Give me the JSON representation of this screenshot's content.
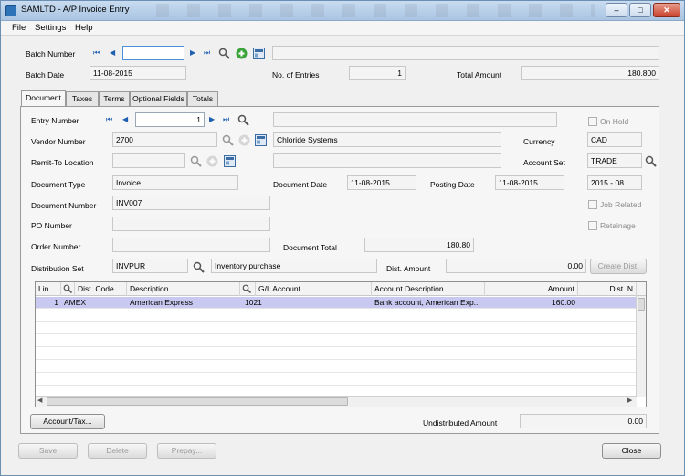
{
  "window": {
    "title": "SAMLTD - A/P Invoice Entry",
    "controls": {
      "minimize": "–",
      "maximize": "□",
      "close": "✕"
    }
  },
  "menu": [
    "File",
    "Settings",
    "Help"
  ],
  "header": {
    "batch_number_label": "Batch Number",
    "batch_number_value": "",
    "batch_date_label": "Batch Date",
    "batch_date_value": "11-08-2015",
    "entries_label": "No. of Entries",
    "entries_value": "1",
    "total_amount_label": "Total Amount",
    "total_amount_value": "180.800"
  },
  "tabs": [
    {
      "label": "Document"
    },
    {
      "label": "Taxes"
    },
    {
      "label": "Terms"
    },
    {
      "label": "Optional Fields"
    },
    {
      "label": "Totals"
    }
  ],
  "document": {
    "entry_number_label": "Entry Number",
    "entry_number_value": "1",
    "on_hold_label": "On Hold",
    "vendor_number_label": "Vendor Number",
    "vendor_number_value": "2700",
    "vendor_name_value": "Chloride Systems",
    "currency_label": "Currency",
    "currency_value": "CAD",
    "remit_to_label": "Remit-To Location",
    "remit_to_value": "",
    "account_set_label": "Account Set",
    "account_set_value": "TRADE",
    "document_type_label": "Document Type",
    "document_type_value": "Invoice",
    "document_date_label": "Document Date",
    "document_date_value": "11-08-2015",
    "posting_date_label": "Posting Date",
    "posting_date_value": "11-08-2015",
    "fiscal_period_value": "2015 - 08",
    "document_number_label": "Document Number",
    "document_number_value": "INV007",
    "job_related_label": "Job Related",
    "po_number_label": "PO Number",
    "po_number_value": "",
    "retainage_label": "Retainage",
    "order_number_label": "Order Number",
    "order_number_value": "",
    "document_total_label": "Document Total",
    "document_total_value": "180.80",
    "distribution_set_label": "Distribution Set",
    "distribution_set_value": "INVPUR",
    "distribution_set_desc": "Inventory purchase",
    "dist_amount_label": "Dist. Amount",
    "dist_amount_value": "0.00",
    "create_dist_label": "Create Dist."
  },
  "grid": {
    "headers": [
      "Lin...",
      "Dist. Code",
      "Description",
      "G/L Account",
      "Account Description",
      "Amount",
      "Dist. N"
    ],
    "rows": [
      [
        "1",
        "AMEX",
        "American Express",
        "1021",
        "Bank account, American Exp...",
        "160.00",
        ""
      ]
    ]
  },
  "footer": {
    "account_tax_label": "Account/Tax...",
    "undistributed_label": "Undistributed Amount",
    "undistributed_value": "0.00",
    "save_label": "Save",
    "delete_label": "Delete",
    "prepay_label": "Prepay...",
    "close_label": "Close"
  },
  "colors": {
    "selected_row": "#c8c8f0",
    "nav_blue": "#1f5fb0",
    "add_green": "#3aa43a"
  },
  "icons": [
    "app-icon",
    "first-icon",
    "prev-icon",
    "next-icon",
    "last-icon",
    "search-icon",
    "add-icon",
    "zoom-icon"
  ]
}
